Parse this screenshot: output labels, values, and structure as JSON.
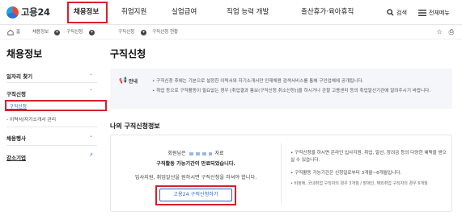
{
  "header": {
    "logo_text": "고용24",
    "nav": [
      {
        "label": "채용정보",
        "active": true
      },
      {
        "label": "취업지원",
        "active": false
      },
      {
        "label": "실업급여",
        "active": false
      },
      {
        "label": "직업 능력 개발",
        "active": false
      },
      {
        "label": "출산휴가·육아휴직",
        "active": false
      }
    ],
    "search_label": "검색",
    "menu_label": "전체메뉴"
  },
  "breadcrumb": {
    "items": [
      "홈",
      "채용정보",
      "구직신청",
      "구직신청",
      "구직신청 현황"
    ],
    "tools": [
      "star-icon",
      "print-icon"
    ]
  },
  "sidebar": {
    "title": "채용정보",
    "items": [
      {
        "label": "일자리 찾기"
      },
      {
        "label": "구직신청",
        "subitems": [
          {
            "label": "· 구직신청",
            "active": true
          },
          {
            "label": "- 이력서/자기소개서 관리",
            "active": false
          }
        ]
      },
      {
        "label": "채용행사"
      },
      {
        "label": "강소기업"
      }
    ]
  },
  "main": {
    "title": "구직신청",
    "notice": {
      "label": "안내",
      "bullet1": "• 구직신청 후에는 기본으로 설정한 이력서와 자기소개서만 인재채용 검색서비스를 통해 구인업체에 공개됩니다.",
      "bullet2": "• 취업 등으로 구직활동이 필요없는 경우 [취업결과 통보(구직신청 취소신청)]을 하시거나 관할 고용센터 등의 취업알선기관에 알려주시기 바랍니다."
    },
    "section_title": "나의 구직신청정보",
    "status": {
      "line_a_prefix": "회원님은",
      "line_a_suffix": "자료",
      "line_b": "구직활동 가능기간이 만료되었습니다.",
      "line_c": "입사지원, 취업알선을 원하시면 구직신청을 하셔야 합니다.",
      "button": "고용24 구직신청하기"
    },
    "info": {
      "r1": "• 구직신청을 하시면 온라인 입사지원, 취업, 알선, 장려금 등의 다양한 혜택을 받으실 수 있습니다.",
      "r2": "• 구직활동 가능기간은 신청일로부터 3개월~6개월입니다.",
      "r3": "• 비정에, 국내취업 구직자의 경우 3개월 / 장애인, 해외취업 구직자의 경우 6개월"
    }
  },
  "colors": {
    "highlight": "#d81f2a",
    "link": "#2a64c9",
    "notice_icon": "#2f9e4b"
  }
}
